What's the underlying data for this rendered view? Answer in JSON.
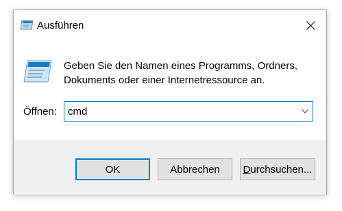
{
  "window": {
    "title": "Ausführen",
    "app_icon": "run-icon",
    "close_icon": "close-icon"
  },
  "content": {
    "description_line1": "Geben Sie den Namen eines Programms, Ordners,",
    "description_line2": "Dokuments oder einer Internetressource an.",
    "open_label": "Öffnen:",
    "input_value": "cmd",
    "dropdown_icon": "chevron-down-icon"
  },
  "buttons": {
    "ok": "OK",
    "cancel": "Abbrechen",
    "browse_underlined": "D",
    "browse_rest": "urchsuchen..."
  },
  "colors": {
    "accent": "#0078d7",
    "footer_bg": "#f0f0f0",
    "button_bg": "#e1e1e1"
  }
}
